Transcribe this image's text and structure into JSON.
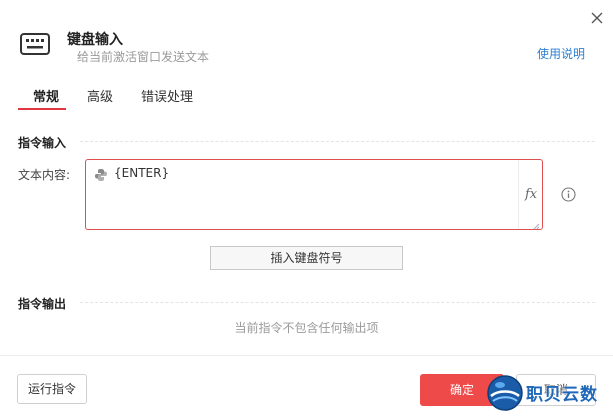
{
  "header": {
    "title": "键盘输入",
    "subtitle": "给当前激活窗口发送文本",
    "help_label": "使用说明"
  },
  "tabs": [
    {
      "label": "常规",
      "active": true
    },
    {
      "label": "高级",
      "active": false
    },
    {
      "label": "错误处理",
      "active": false
    }
  ],
  "input_section": {
    "title": "指令输入",
    "field_label": "文本内容:",
    "field_value": "{ENTER}",
    "fx_label": "fx",
    "insert_button_label": "插入键盘符号"
  },
  "output_section": {
    "title": "指令输出",
    "empty_text": "当前指令不包含任何输出项"
  },
  "footer": {
    "run_label": "运行指令",
    "ok_label": "确定",
    "cancel_label": "取消"
  },
  "watermark": {
    "text": "职贝云数"
  },
  "colors": {
    "accent": "#e0383e",
    "ok_button": "#ef4a4a",
    "link": "#2d7fd2",
    "error_border": "#e05050"
  },
  "icons": {
    "header": "keyboard-icon",
    "close": "close-icon",
    "field_prefix": "python-icon",
    "info": "info-icon",
    "resize": "resize-grip-icon",
    "watermark": "globe-logo-icon"
  }
}
